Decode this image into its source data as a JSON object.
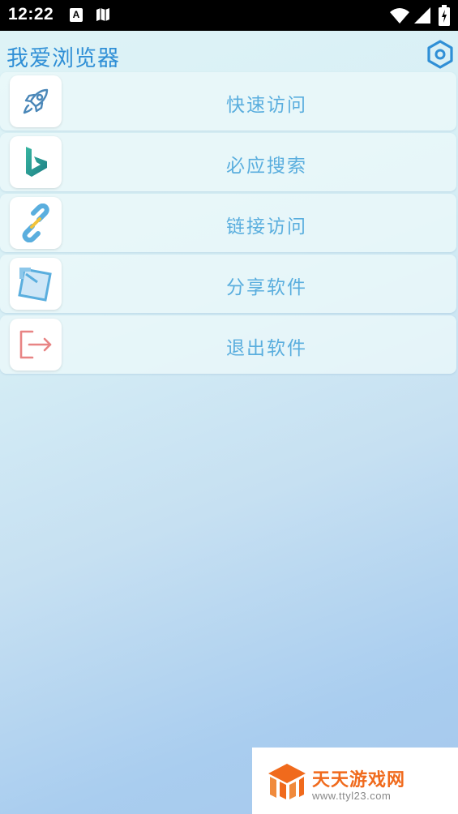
{
  "status_bar": {
    "time": "12:22",
    "notification_a": "A",
    "icons": [
      "notification-a-icon",
      "map-icon",
      "wifi-icon",
      "signal-icon",
      "battery-icon"
    ]
  },
  "app_bar": {
    "title": "我爱浏览器",
    "settings_icon": "hexagon-settings-icon",
    "accent_color": "#2f8fd6"
  },
  "menu": {
    "label_color": "#5aaede",
    "items": [
      {
        "label": "快速访问",
        "icon": "rocket-icon"
      },
      {
        "label": "必应搜索",
        "icon": "bing-icon"
      },
      {
        "label": "链接访问",
        "icon": "link-icon"
      },
      {
        "label": "分享软件",
        "icon": "share-icon"
      },
      {
        "label": "退出软件",
        "icon": "exit-icon"
      }
    ]
  },
  "watermark": {
    "title": "天天游戏网",
    "url": "www.ttyl23.com",
    "color": "#f06a1c"
  }
}
